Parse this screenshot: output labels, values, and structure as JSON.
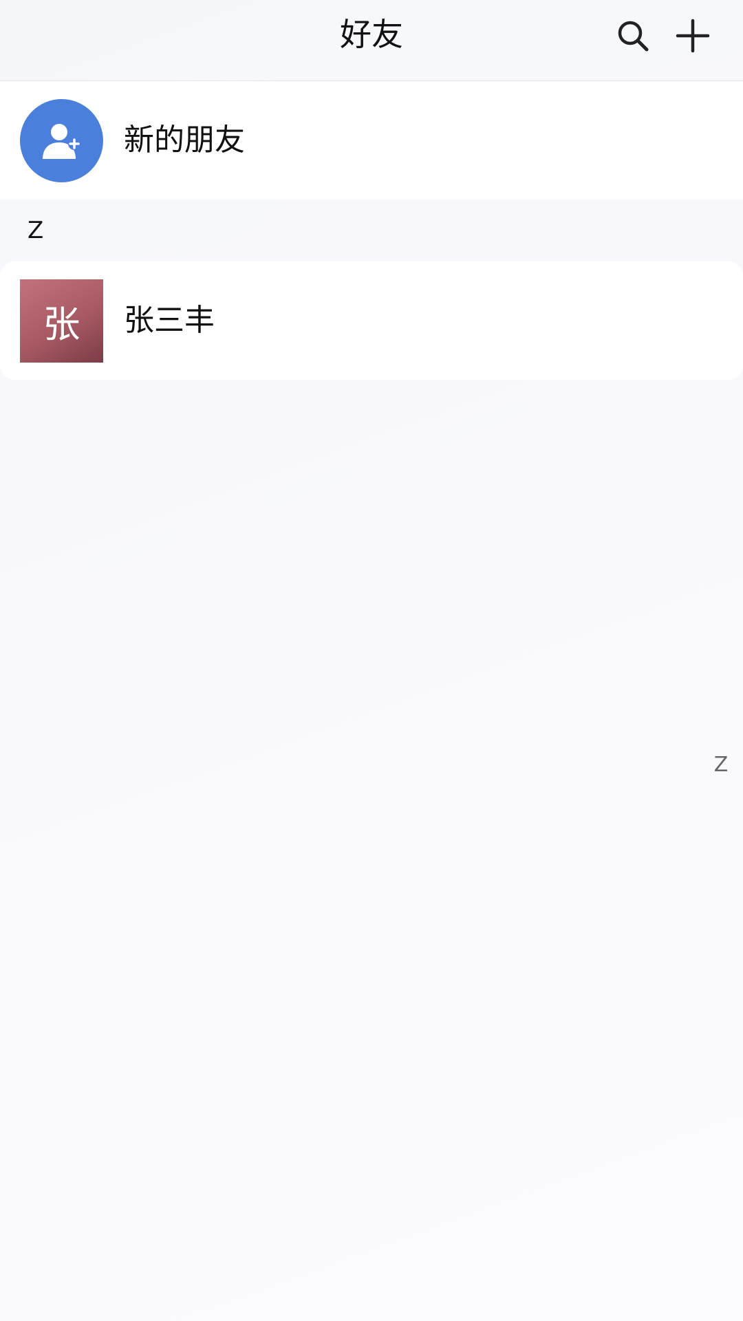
{
  "header": {
    "title": "好友",
    "search_icon": "search-icon",
    "add_icon": "plus-icon"
  },
  "new_friends": {
    "label": "新的朋友",
    "icon": "add-user-icon",
    "icon_bg": "#4a7fdc"
  },
  "sections": [
    {
      "letter": "Z",
      "contacts": [
        {
          "avatar_text": "张",
          "name": "张三丰",
          "avatar_color": "#a85a64"
        }
      ]
    }
  ],
  "index_bar": [
    "Z"
  ]
}
